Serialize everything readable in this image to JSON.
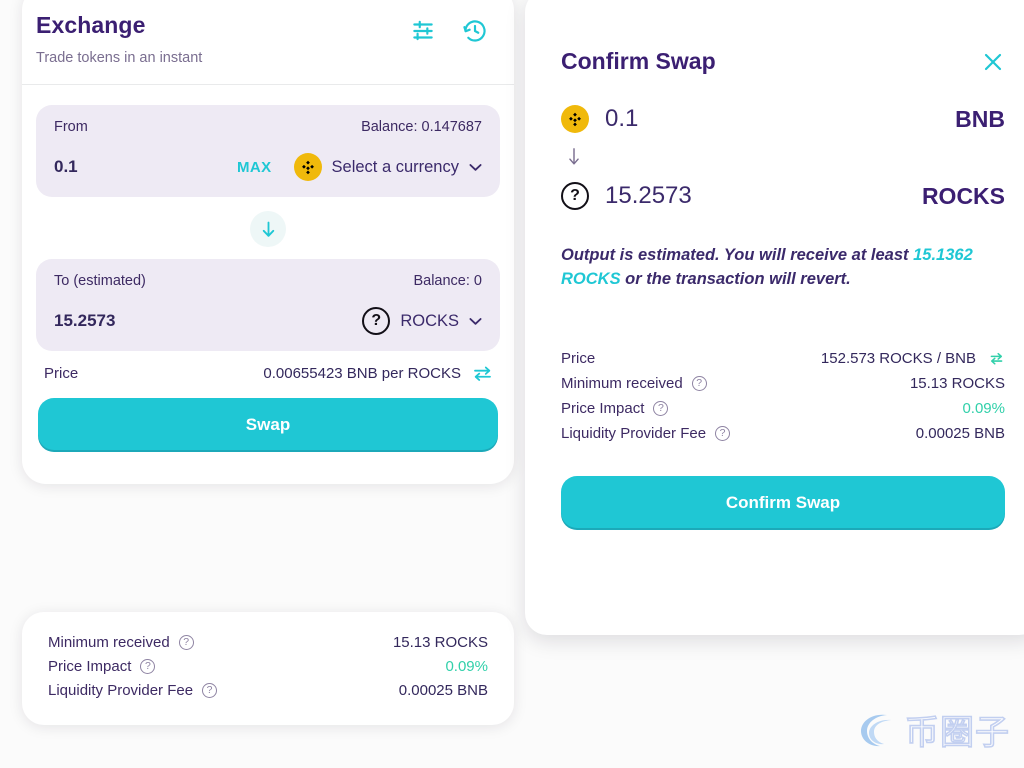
{
  "exchange": {
    "title": "Exchange",
    "subtitle": "Trade tokens in an instant",
    "settings_icon": "settings-sliders-icon",
    "history_icon": "history-clock-icon",
    "from": {
      "label": "From",
      "balance": "Balance: 0.147687",
      "amount": "0.1",
      "max_label": "MAX",
      "currency": "Select a currency",
      "token_icon": "bnb-token-icon"
    },
    "switch_icon": "arrow-down-icon",
    "to": {
      "label": "To (estimated)",
      "balance": "Balance: 0",
      "amount": "15.2573",
      "currency": "ROCKS",
      "token_icon": "unknown-token-icon"
    },
    "price": {
      "label": "Price",
      "value": "0.00655423 BNB per ROCKS",
      "toggle_icon": "swap-direction-icon"
    },
    "swap_button": "Swap",
    "details": [
      {
        "label": "Minimum received",
        "value": "15.13 ROCKS",
        "accent": false
      },
      {
        "label": "Price Impact",
        "value": "0.09%",
        "accent": true
      },
      {
        "label": "Liquidity Provider Fee",
        "value": "0.00025 BNB",
        "accent": false
      }
    ]
  },
  "modal": {
    "title": "Confirm Swap",
    "close_icon": "close-icon",
    "from": {
      "amount": "0.1",
      "symbol": "BNB",
      "token_icon": "bnb-token-icon"
    },
    "arrow_icon": "arrow-down-icon",
    "to": {
      "amount": "15.2573",
      "symbol": "ROCKS",
      "token_icon": "unknown-token-icon"
    },
    "note": {
      "prefix": "Output is estimated. You will receive at least ",
      "highlight": "15.1362 ROCKS",
      "suffix": " or the transaction will revert."
    },
    "details": [
      {
        "label": "Price",
        "value": "152.573 ROCKS / BNB",
        "accent": false,
        "help": false,
        "refresh": true
      },
      {
        "label": "Minimum received",
        "value": "15.13 ROCKS",
        "accent": false,
        "help": true,
        "refresh": false
      },
      {
        "label": "Price Impact",
        "value": "0.09%",
        "accent": true,
        "help": true,
        "refresh": false
      },
      {
        "label": "Liquidity Provider Fee",
        "value": "0.00025 BNB",
        "accent": false,
        "help": true,
        "refresh": false
      }
    ],
    "confirm_button": "Confirm Swap"
  },
  "watermark": {
    "text": "币圈子",
    "logo_icon": "circle-logo-icon"
  },
  "colors": {
    "accent": "#1FC7D4",
    "purple": "#3B1F72",
    "panel": "#EEEAF4",
    "green": "#31D0AA",
    "bnb_yellow": "#F0B90B"
  }
}
